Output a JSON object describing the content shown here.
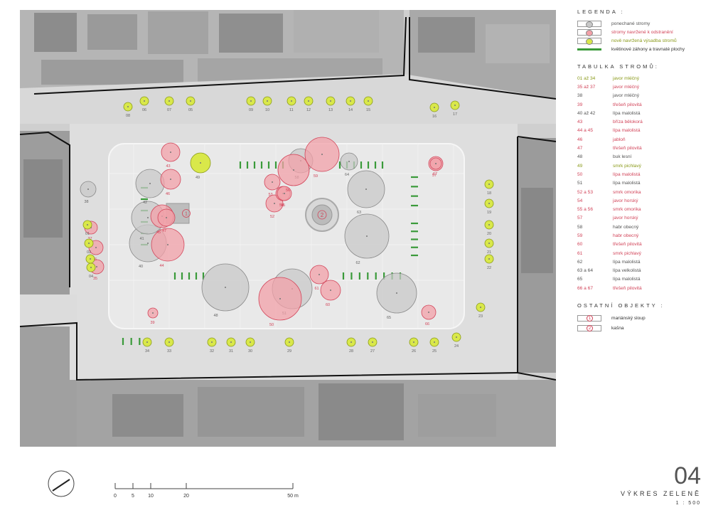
{
  "colors": {
    "kept": "#c8c8c8",
    "remove": "#f2a0a8",
    "new": "#d9e84a",
    "bed": "#3a9a3a",
    "remove_text": "#d2455a",
    "kept_text": "#555555",
    "new_text": "#8a9a1a"
  },
  "legend": {
    "title": "LEGENDA :",
    "items": [
      {
        "key": "kept",
        "label": "ponechané stromy",
        "color": "#555555"
      },
      {
        "key": "remove",
        "label": "stromy navržené k odstranění",
        "color": "#d2455a"
      },
      {
        "key": "new",
        "label": "nově navržená výsadba stromů",
        "color": "#8a9a1a"
      },
      {
        "key": "bed",
        "label": "květinové záhony a travnaté plochy",
        "color": "#333333"
      }
    ]
  },
  "tree_table": {
    "title": "TABULKA STROMŮ:",
    "rows": [
      {
        "id": "01 až 34",
        "name": "javor mléčný",
        "status": "new"
      },
      {
        "id": "35 až 37",
        "name": "javor mléčný",
        "status": "remove"
      },
      {
        "id": "38",
        "name": "javor mléčný",
        "status": "kept"
      },
      {
        "id": "39",
        "name": "třešeň pilovitá",
        "status": "remove"
      },
      {
        "id": "40 až 42",
        "name": "lípa malolistá",
        "status": "kept"
      },
      {
        "id": "43",
        "name": "bříza bělokorá",
        "status": "remove"
      },
      {
        "id": "44 a 45",
        "name": "lípa malolistá",
        "status": "remove"
      },
      {
        "id": "46",
        "name": "jabloň",
        "status": "remove"
      },
      {
        "id": "47",
        "name": "třešeň pilovitá",
        "status": "remove"
      },
      {
        "id": "48",
        "name": "buk lesní",
        "status": "kept"
      },
      {
        "id": "49",
        "name": "smrk pichlavý",
        "status": "new"
      },
      {
        "id": "50",
        "name": "lípa malolistá",
        "status": "remove"
      },
      {
        "id": "51",
        "name": "lípa malolistá",
        "status": "kept"
      },
      {
        "id": "52 a 53",
        "name": "smrk omorika",
        "status": "remove"
      },
      {
        "id": "54",
        "name": "javor horský",
        "status": "remove"
      },
      {
        "id": "55 a 56",
        "name": "smrk omorika",
        "status": "remove"
      },
      {
        "id": "57",
        "name": "javor horský",
        "status": "remove"
      },
      {
        "id": "58",
        "name": "habr obecný",
        "status": "kept"
      },
      {
        "id": "59",
        "name": "habr obecný",
        "status": "remove"
      },
      {
        "id": "60",
        "name": "třešeň pilovitá",
        "status": "remove"
      },
      {
        "id": "61",
        "name": "smrk pichlavý",
        "status": "remove"
      },
      {
        "id": "62",
        "name": "lípa malolistá",
        "status": "kept"
      },
      {
        "id": "63 a 64",
        "name": "lípa velkolistá",
        "status": "kept"
      },
      {
        "id": "65",
        "name": "lípa malolistá",
        "status": "kept"
      },
      {
        "id": "66 a 67",
        "name": "třešeň pilovitá",
        "status": "remove"
      }
    ]
  },
  "other_objects": {
    "title": "OSTATNÍ OBJEKTY :",
    "items": [
      {
        "num": "1",
        "label": "mariánský sloup"
      },
      {
        "num": "2",
        "label": "kašna"
      }
    ]
  },
  "sheet": {
    "number": "04",
    "title": "VÝKRES ZELENĚ",
    "scale": "1 : 500"
  },
  "scalebar": {
    "labels": [
      "0",
      "5",
      "10",
      "20",
      "50 m"
    ],
    "values_m": [
      0,
      5,
      10,
      20,
      50
    ]
  },
  "markers": [
    {
      "n": "1"
    },
    {
      "n": "2"
    }
  ],
  "trees_new": [
    {
      "id": "01"
    },
    {
      "id": "02"
    },
    {
      "id": "03"
    },
    {
      "id": "04"
    },
    {
      "id": "05"
    },
    {
      "id": "06"
    },
    {
      "id": "07"
    },
    {
      "id": "08"
    },
    {
      "id": "09"
    },
    {
      "id": "10"
    },
    {
      "id": "11"
    },
    {
      "id": "12"
    },
    {
      "id": "13"
    },
    {
      "id": "14"
    },
    {
      "id": "15"
    },
    {
      "id": "16"
    },
    {
      "id": "17"
    },
    {
      "id": "18"
    },
    {
      "id": "19"
    },
    {
      "id": "20"
    },
    {
      "id": "21"
    },
    {
      "id": "22"
    },
    {
      "id": "23"
    },
    {
      "id": "24"
    },
    {
      "id": "25"
    },
    {
      "id": "26"
    },
    {
      "id": "27"
    },
    {
      "id": "28"
    },
    {
      "id": "29"
    },
    {
      "id": "30"
    },
    {
      "id": "31"
    },
    {
      "id": "32"
    },
    {
      "id": "33"
    },
    {
      "id": "34"
    },
    {
      "id": "49"
    }
  ],
  "trees_kept": [
    {
      "id": "38"
    },
    {
      "id": "40"
    },
    {
      "id": "41"
    },
    {
      "id": "42"
    },
    {
      "id": "48"
    },
    {
      "id": "51"
    },
    {
      "id": "58"
    },
    {
      "id": "62"
    },
    {
      "id": "63"
    },
    {
      "id": "64"
    },
    {
      "id": "65"
    }
  ],
  "trees_remove": [
    {
      "id": "35"
    },
    {
      "id": "36"
    },
    {
      "id": "37"
    },
    {
      "id": "39"
    },
    {
      "id": "43"
    },
    {
      "id": "44"
    },
    {
      "id": "45"
    },
    {
      "id": "46"
    },
    {
      "id": "47"
    },
    {
      "id": "50"
    },
    {
      "id": "52"
    },
    {
      "id": "53"
    },
    {
      "id": "54"
    },
    {
      "id": "55"
    },
    {
      "id": "56"
    },
    {
      "id": "57"
    },
    {
      "id": "59"
    },
    {
      "id": "60"
    },
    {
      "id": "61"
    },
    {
      "id": "66"
    },
    {
      "id": "67"
    }
  ]
}
